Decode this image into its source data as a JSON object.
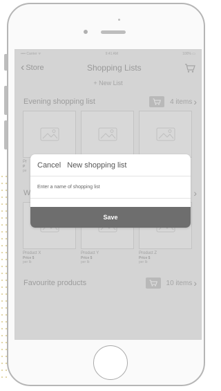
{
  "status_bar": {
    "carrier": "•••• Carrier ᯤ",
    "time": "9:41 AM",
    "battery": "100% ▭"
  },
  "nav": {
    "back_label": "Store",
    "title": "Shopping Lists"
  },
  "new_list_label": "+ New List",
  "sections": [
    {
      "title": "Evening shopping list",
      "count": "4 items",
      "products": [
        {
          "name": "Pr",
          "price": "P",
          "unit": "pe"
        },
        {
          "name": "",
          "price": "",
          "unit": ""
        },
        {
          "name": "",
          "price": "",
          "unit": ""
        }
      ]
    },
    {
      "title": "W",
      "count": "",
      "products": [
        {
          "name": "Product X",
          "price": "Price $",
          "unit": "per lb"
        },
        {
          "name": "Product Y",
          "price": "Price $",
          "unit": "per lb"
        },
        {
          "name": "Product Z",
          "price": "Price $",
          "unit": "per lb"
        }
      ]
    },
    {
      "title": "Favourite products",
      "count": "10 items"
    }
  ],
  "dialog": {
    "cancel_label": "Cancel",
    "title": "New shopping list",
    "input_placeholder": "Enter a name of shopping list",
    "save_label": "Save"
  },
  "icons": [
    "cart-icon",
    "image-placeholder-icon",
    "chevron-right-icon",
    "chevron-left-icon"
  ],
  "colors": {
    "dialog_save_bg": "#6e6e6e",
    "screen_bg": "#ececec",
    "overlay": "#969696"
  }
}
